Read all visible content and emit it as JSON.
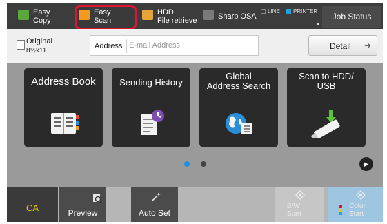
{
  "topbar": {
    "tabs": [
      {
        "line1": "Easy",
        "line2": "Copy",
        "icon": "copy-icon"
      },
      {
        "line1": "Easy",
        "line2": "Scan",
        "icon": "scan-icon",
        "selected": true
      },
      {
        "line1": "HDD",
        "line2": "File retrieve",
        "icon": "folder-icon"
      },
      {
        "line1": "Sharp OSA",
        "line2": "",
        "icon": "osa-icon"
      }
    ],
    "indicators": {
      "line": "LINE",
      "printer": "PRINTER"
    },
    "job_status": "Job Status",
    "colors": {
      "highlight": "#e2142f",
      "copy": "#5aa83c",
      "scan": "#f39a1f",
      "printer": "#22a3e0"
    }
  },
  "address_row": {
    "original_label": "Original",
    "original_size": "8½x11",
    "address_label": "Address",
    "address_placeholder": "E-mail Address",
    "detail_label": "Detail"
  },
  "tiles": [
    {
      "line1": "Address Book",
      "line2": "",
      "icon": "address-book-icon"
    },
    {
      "line1": "Sending History",
      "line2": "",
      "icon": "history-icon"
    },
    {
      "line1": "Global",
      "line2": "Address Search",
      "icon": "global-search-icon"
    },
    {
      "line1": "Scan to HDD/",
      "line2": "USB",
      "icon": "usb-icon"
    }
  ],
  "pagination": {
    "current": 1,
    "total": 2,
    "active_color": "#1c8de0"
  },
  "bottom": {
    "ca": "CA",
    "preview": "Preview",
    "auto_set": "Auto Set",
    "bw_start": "B/W Start",
    "color_start": "Color Start"
  }
}
